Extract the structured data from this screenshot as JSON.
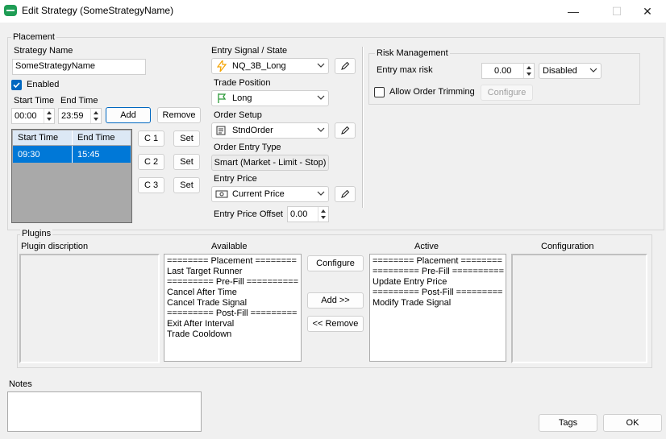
{
  "window": {
    "title": "Edit Strategy (SomeStrategyName)",
    "minimize": "—",
    "maximize": "☐",
    "close": "✕"
  },
  "placement": {
    "group_title": "Placement",
    "strategy_name_label": "Strategy Name",
    "strategy_name_value": "SomeStrategyName",
    "enabled_label": "Enabled",
    "enabled_checked": true,
    "start_time_label": "Start Time",
    "end_time_label": "End Time",
    "start_time_value": "00:00",
    "end_time_value": "23:59",
    "add_button": "Add",
    "remove_button": "Remove",
    "grid_columns": [
      "Start Time",
      "End Time"
    ],
    "grid_rows": [
      {
        "start": "09:30",
        "end": "15:45"
      }
    ],
    "c_buttons": [
      "C 1",
      "C 2",
      "C 3"
    ],
    "set_button": "Set"
  },
  "entry": {
    "signal_label": "Entry Signal / State",
    "signal_value": "NQ_3B_Long",
    "position_label": "Trade Position",
    "position_value": "Long",
    "order_setup_label": "Order Setup",
    "order_setup_value": "StndOrder",
    "order_type_label": "Order Entry Type",
    "order_type_value": "Smart (Market - Limit - Stop)",
    "price_label": "Entry Price",
    "price_value": "Current Price",
    "offset_label": "Entry Price Offset",
    "offset_value": "0.00"
  },
  "risk": {
    "group_title": "Risk Management",
    "max_risk_label": "Entry max risk",
    "max_risk_value": "0.00",
    "mode_value": "Disabled",
    "trimming_label": "Allow Order Trimming",
    "trimming_checked": false,
    "configure_button": "Configure"
  },
  "plugins": {
    "group_title": "Plugins",
    "description_header": "Plugin discription",
    "available_header": "Available",
    "active_header": "Active",
    "configuration_header": "Configuration",
    "available_items": [
      "======== Placement ========",
      "Last Target Runner",
      "========= Pre-Fill ==========",
      "Cancel After Time",
      "Cancel Trade Signal",
      "========= Post-Fill =========",
      "Exit After Interval",
      "Trade Cooldown"
    ],
    "active_items": [
      "======== Placement ========",
      "========= Pre-Fill ==========",
      "Update Entry Price",
      "========= Post-Fill =========",
      "Modify Trade Signal"
    ],
    "configure_button": "Configure",
    "add_button": "Add >>",
    "remove_button": "<< Remove"
  },
  "notes": {
    "label": "Notes",
    "value": ""
  },
  "footer": {
    "tags_button": "Tags",
    "ok_button": "OK"
  },
  "colors": {
    "accent": "#0067c0",
    "selection": "#0078d7",
    "grid_header": "#dce8f5",
    "flag": "#2e9a3a",
    "lightning": "#f5a300"
  }
}
